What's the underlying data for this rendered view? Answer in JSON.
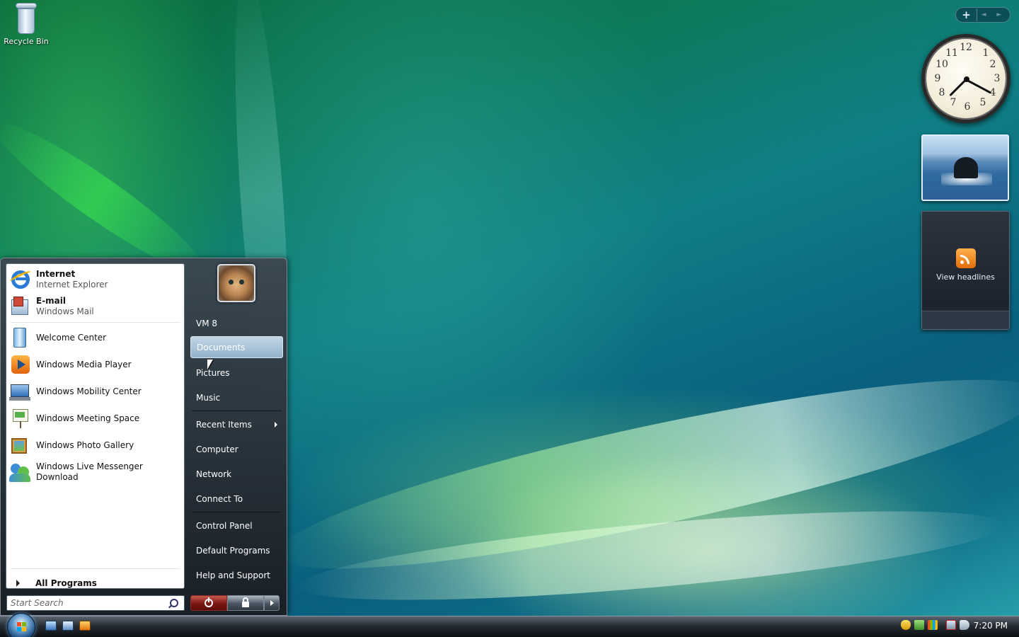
{
  "desktop": {
    "icons": [
      {
        "label": "Recycle Bin",
        "icon": "recycle-bin-icon"
      }
    ]
  },
  "sidebar": {
    "add_label": "+",
    "nav_label": "◄ ►",
    "clock": {
      "numbers": [
        "12",
        "1",
        "2",
        "3",
        "4",
        "5",
        "6",
        "7",
        "8",
        "9",
        "10",
        "11"
      ]
    },
    "feed": {
      "label": "View headlines",
      "icon": "rss-icon"
    }
  },
  "start_menu": {
    "pinned": [
      {
        "title": "Internet",
        "subtitle": "Internet Explorer",
        "icon": "internet-explorer-icon"
      },
      {
        "title": "E-mail",
        "subtitle": "Windows Mail",
        "icon": "windows-mail-icon"
      }
    ],
    "recent": [
      {
        "label": "Welcome Center",
        "icon": "welcome-center-icon"
      },
      {
        "label": "Windows Media Player",
        "icon": "media-player-icon"
      },
      {
        "label": "Windows Mobility Center",
        "icon": "mobility-center-icon"
      },
      {
        "label": "Windows Meeting Space",
        "icon": "meeting-space-icon"
      },
      {
        "label": "Windows Photo Gallery",
        "icon": "photo-gallery-icon"
      },
      {
        "label": "Windows Live Messenger Download",
        "icon": "messenger-icon"
      }
    ],
    "all_programs": "All Programs",
    "search_placeholder": "Start Search",
    "user_name": "VM 8",
    "links": [
      {
        "label": "Documents",
        "highlighted": true
      },
      {
        "label": "Pictures"
      },
      {
        "label": "Music"
      },
      {
        "label": "Recent Items",
        "submenu": true
      },
      {
        "label": "Computer"
      },
      {
        "label": "Network"
      },
      {
        "label": "Connect To"
      },
      {
        "label": "Control Panel"
      },
      {
        "label": "Default Programs"
      },
      {
        "label": "Help and Support"
      }
    ],
    "power_icon": "power-icon",
    "lock_icon": "lock-icon"
  },
  "taskbar": {
    "quick_launch": [
      "show-desktop-icon",
      "switch-windows-icon",
      "media-player-icon"
    ],
    "tray": [
      "security-shield-icon",
      "network-check-icon",
      "windows-icon",
      "network-disconnected-icon",
      "volume-muted-icon"
    ],
    "time": "7:20 PM"
  },
  "colors": {
    "highlight": "#94b3cc",
    "power": "#7b1712"
  }
}
